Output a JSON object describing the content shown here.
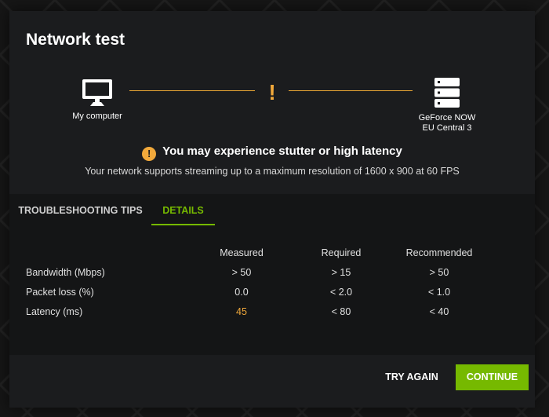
{
  "dialog": {
    "title": "Network test"
  },
  "connection": {
    "computer_label": "My computer",
    "server_label_line1": "GeForce NOW",
    "server_label_line2": "EU Central 3",
    "warning_glyph": "!"
  },
  "warning": {
    "icon_glyph": "!",
    "headline": "You may experience stutter or high latency",
    "detail": "Your network supports streaming up to a maximum resolution of 1600 x 900 at 60 FPS"
  },
  "tabs": [
    {
      "label": "TROUBLESHOOTING TIPS",
      "active": false
    },
    {
      "label": "DETAILS",
      "active": true
    }
  ],
  "metrics": {
    "headers": {
      "measured": "Measured",
      "required": "Required",
      "recommended": "Recommended"
    },
    "rows": [
      {
        "label": "Bandwidth (Mbps)",
        "measured": "> 50",
        "required": "> 15",
        "recommended": "> 50"
      },
      {
        "label": "Packet loss (%)",
        "measured": "0.0",
        "required": "< 2.0",
        "recommended": "< 1.0"
      },
      {
        "label": "Latency (ms)",
        "measured": "45",
        "required": "< 80",
        "recommended": "< 40"
      }
    ]
  },
  "footer": {
    "try_again_label": "TRY AGAIN",
    "continue_label": "CONTINUE"
  },
  "colors": {
    "accent_green": "#76b900",
    "warning_orange": "#f2a93b",
    "connector_line": "#e8a534"
  },
  "icons": {
    "computer": "monitor-icon",
    "server": "server-icon",
    "warning": "warning-circle-icon"
  }
}
